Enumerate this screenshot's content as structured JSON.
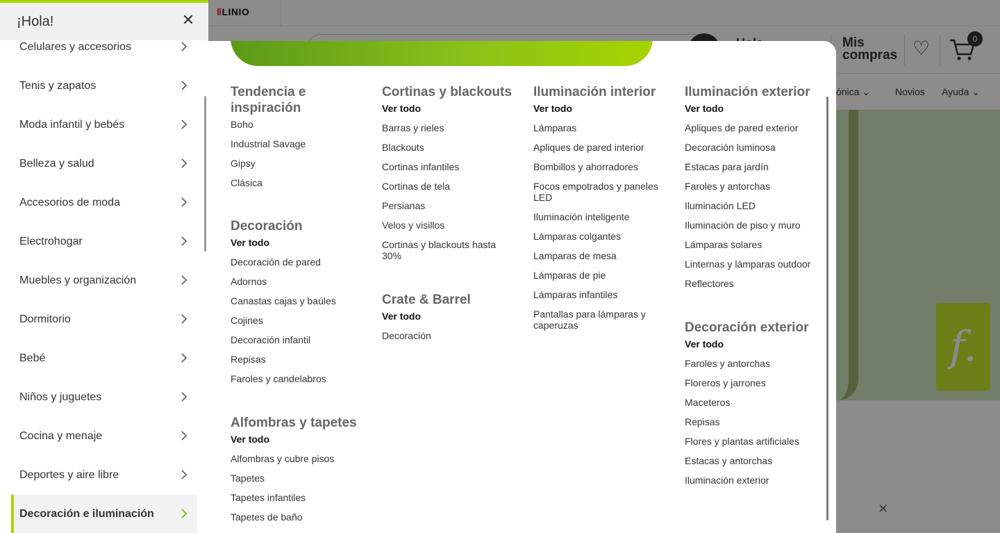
{
  "background": {
    "logo": "LINIO",
    "header_greeting": "Hola",
    "mis_compras": "Mis compras",
    "cart_count": "0",
    "nav": [
      "fónica",
      "Novios",
      "Ayuda"
    ]
  },
  "drawer": {
    "title": "¡Hola!",
    "items": [
      {
        "label": "Celulares y accesorios"
      },
      {
        "label": "Tenis y zapatos"
      },
      {
        "label": "Moda infantil y bebés"
      },
      {
        "label": "Belleza y salud"
      },
      {
        "label": "Accesorios de moda"
      },
      {
        "label": "Electrohogar"
      },
      {
        "label": "Muebles y organización"
      },
      {
        "label": "Dormitorio"
      },
      {
        "label": "Bebé"
      },
      {
        "label": "Niños y juguetes"
      },
      {
        "label": "Cocina y menaje"
      },
      {
        "label": "Deportes y aire libre"
      },
      {
        "label": "Decoración e iluminación"
      }
    ],
    "active_item": "Decoración e iluminación"
  },
  "menu": {
    "columns": [
      {
        "sections": [
          {
            "title": "Tendencia e inspiración",
            "links": [
              "Boho",
              "Industrial Savage",
              "Gipsy",
              "Clásica"
            ]
          },
          {
            "title": "Decoración",
            "links": [
              "Ver todo",
              "Decoración de pared",
              "Adornos",
              "Canastas cajas y baúles",
              "Cojines",
              "Decoración infantil",
              "Repisas",
              "Faroles y candelabros"
            ]
          },
          {
            "title": "Alfombras y tapetes",
            "links": [
              "Ver todo",
              "Alfombras y cubre pisos",
              "Tapetes",
              "Tapetes infantiles",
              "Tapetes de baño"
            ]
          }
        ]
      },
      {
        "sections": [
          {
            "title": "Cortinas y blackouts",
            "links": [
              "Ver todo",
              "Barras y rieles",
              "Blackouts",
              "Cortinas infantiles",
              "Cortinas de tela",
              "Persianas",
              "Velos y visillos",
              "Cortinas y blackouts hasta 30%"
            ]
          },
          {
            "title": "Crate & Barrel",
            "links": [
              "Ver todo",
              "Decoración"
            ]
          }
        ]
      },
      {
        "sections": [
          {
            "title": "Iluminación interior",
            "links": [
              "Ver todo",
              "Lámparas",
              "Apliques de pared interior",
              "Bombillos y ahorradores",
              "Focos empotrados y paneles LED",
              "Iluminación inteligente",
              "Lámparas colgantes",
              "Lamparas de mesa",
              "Lámparas de pie",
              "Lámparas infantiles",
              "Pantallas para lámparas y caperuzas"
            ]
          }
        ]
      },
      {
        "sections": [
          {
            "title": "Iluminación exterior",
            "links": [
              "Ver todo",
              "Apliques de pared exterior",
              "Decoración luminosa",
              "Estacas para jardín",
              "Faroles y antorchas",
              "Iluminación LED",
              "Iluminación de piso y muro",
              "Lámparas solares",
              "Linternas y lámparas outdoor",
              "Reflectores"
            ]
          },
          {
            "title": "Decoración exterior",
            "links": [
              "Ver todo",
              "Faroles y antorchas",
              "Floreros y jarrones",
              "Maceteros",
              "Repisas",
              "Flores y plantas artificiales",
              "Estacas y antorchas",
              "Iluminación exterior"
            ]
          }
        ]
      }
    ]
  },
  "colors": {
    "accent_green": "#a7d400",
    "overlay": "rgba(0,0,0,0.45)",
    "text_dark": "#333333",
    "section_title": "#666666"
  }
}
